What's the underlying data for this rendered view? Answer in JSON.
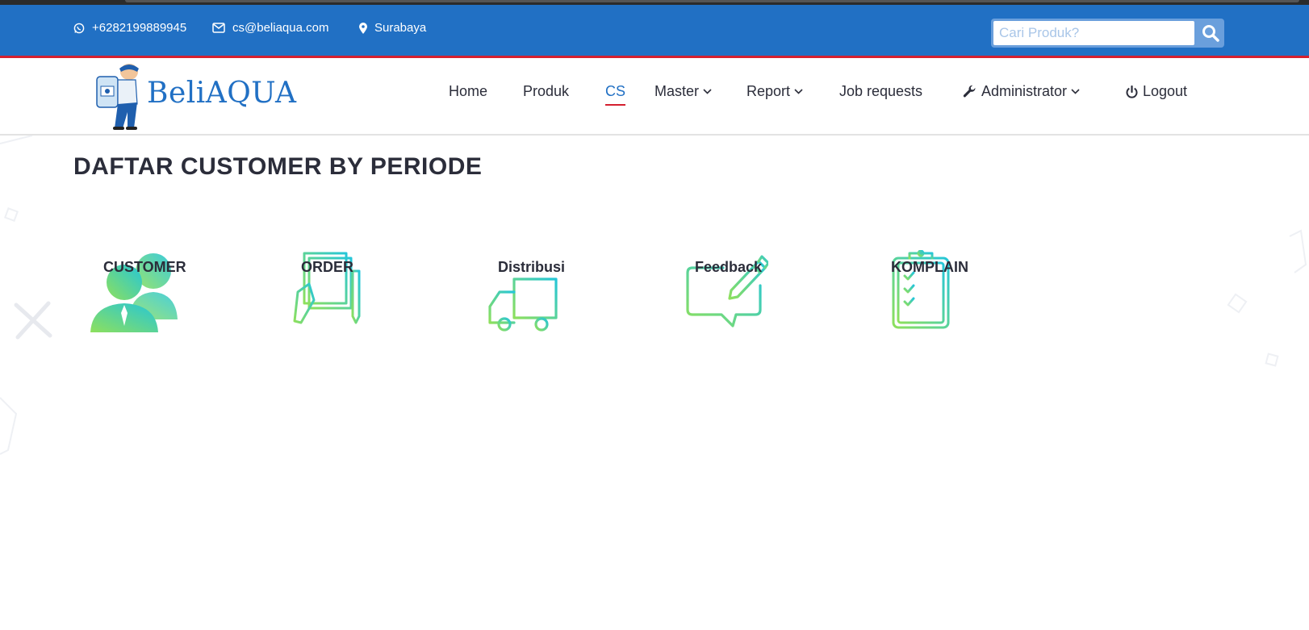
{
  "topbar": {
    "phone": "+6282199889945",
    "email": "cs@beliaqua.com",
    "location": "Surabaya",
    "icons": [
      "whatsapp-icon",
      "envelope-icon",
      "map-marker-icon",
      "search-icon"
    ]
  },
  "search": {
    "placeholder": "Cari Produk?"
  },
  "logo": {
    "text": "BeliAQUA"
  },
  "nav": {
    "home": "Home",
    "produk": "Produk",
    "cs": "CS",
    "master": "Master",
    "report": "Report",
    "job_requests": "Job requests",
    "administrator": "Administrator",
    "logout": "Logout",
    "active": "CS"
  },
  "page": {
    "title": "DAFTAR CUSTOMER BY PERIODE"
  },
  "tiles": [
    {
      "label": "CUSTOMER",
      "icon": "customer-people-icon"
    },
    {
      "label": "ORDER",
      "icon": "order-form-icon"
    },
    {
      "label": "Distribusi",
      "icon": "delivery-truck-icon"
    },
    {
      "label": "Feedback",
      "icon": "feedback-chat-icon"
    },
    {
      "label": "KOMPLAIN",
      "icon": "complaint-clipboard-icon"
    }
  ],
  "colors": {
    "topbar": "#2170c4",
    "accent_red": "#d4202f",
    "icon_gradient_start": "#8ee05c",
    "icon_gradient_end": "#25c6d8"
  }
}
